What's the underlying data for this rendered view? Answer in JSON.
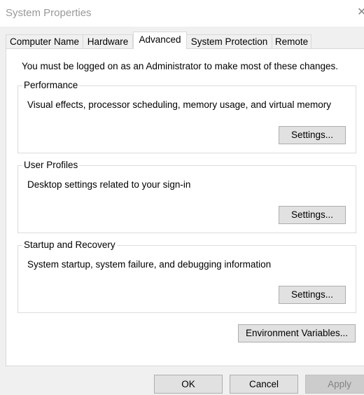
{
  "window": {
    "title": "System Properties",
    "close_glyph": "✕"
  },
  "tabs": [
    {
      "label": "Computer Name",
      "active": false
    },
    {
      "label": "Hardware",
      "active": false
    },
    {
      "label": "Advanced",
      "active": true
    },
    {
      "label": "System Protection",
      "active": false
    },
    {
      "label": "Remote",
      "active": false
    }
  ],
  "advanced": {
    "notice": "You must be logged on as an Administrator to make most of these changes.",
    "groups": [
      {
        "label": "Performance",
        "description": "Visual effects, processor scheduling, memory usage, and virtual memory",
        "button": "Settings..."
      },
      {
        "label": "User Profiles",
        "description": "Desktop settings related to your sign-in",
        "button": "Settings..."
      },
      {
        "label": "Startup and Recovery",
        "description": "System startup, system failure, and debugging information",
        "button": "Settings..."
      }
    ],
    "env_button": "Environment Variables..."
  },
  "footer": {
    "ok": "OK",
    "cancel": "Cancel",
    "apply": "Apply",
    "apply_disabled": true
  }
}
